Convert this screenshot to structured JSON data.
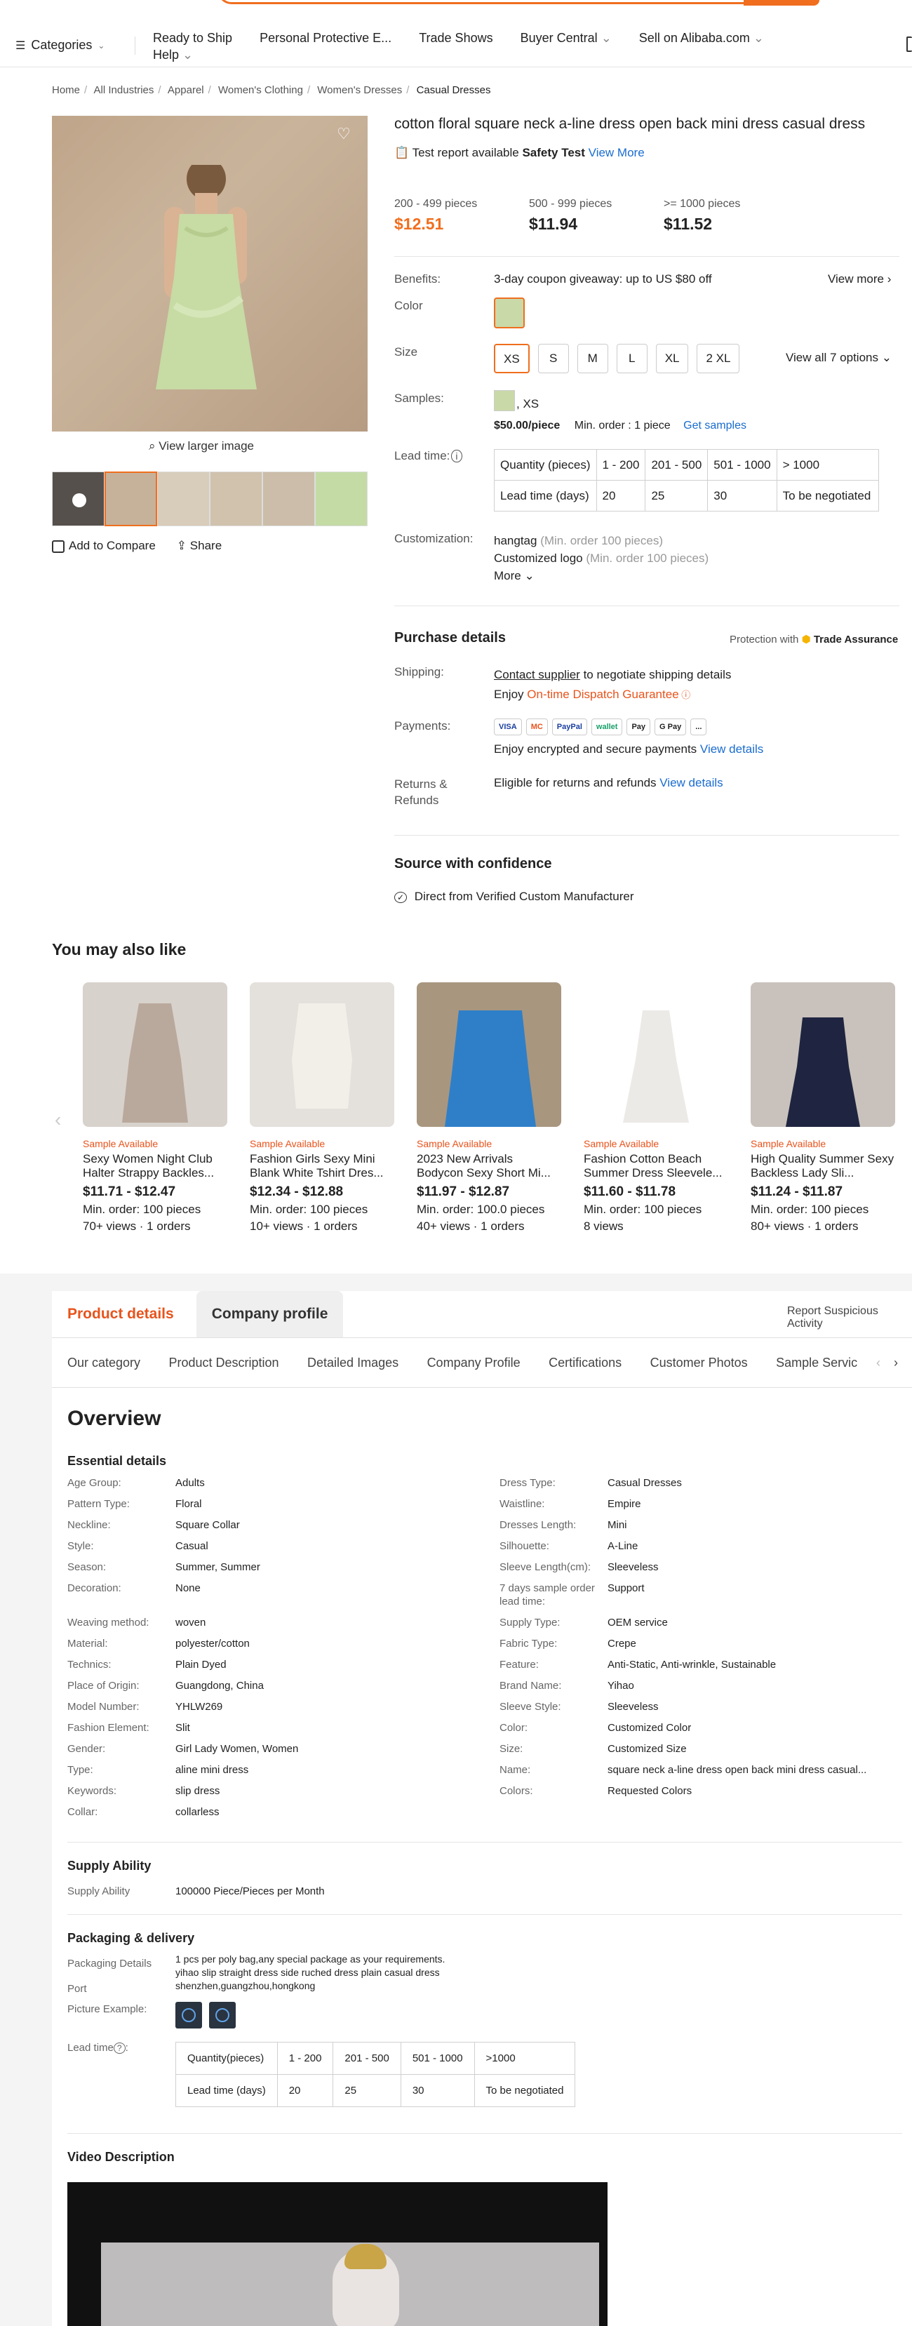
{
  "nav": {
    "categories_label": "Categories",
    "items": [
      "Ready to Ship",
      "Personal Protective E...",
      "Trade Shows",
      "Buyer Central",
      "Sell on Alibaba.com",
      "Help"
    ]
  },
  "breadcrumb": [
    "Home",
    "All Industries",
    "Apparel",
    "Women's Clothing",
    "Women's Dresses",
    "Casual Dresses"
  ],
  "gallery": {
    "view_larger": "View larger image",
    "add_compare": "Add to Compare",
    "share": "Share"
  },
  "product": {
    "title": "cotton floral square neck a-line dress open back mini dress casual dress",
    "report_text": "Test report available",
    "report_bold": "Safety Test",
    "report_link": "View More",
    "tiers": [
      {
        "qty": "200 - 499 pieces",
        "price": "$12.51"
      },
      {
        "qty": "500 - 999 pieces",
        "price": "$11.94"
      },
      {
        "qty": ">= 1000 pieces",
        "price": "$11.52"
      }
    ],
    "benefits_label": "Benefits:",
    "benefits_value": "3-day coupon giveaway: up to US $80 off",
    "view_more": "View more",
    "color_label": "Color",
    "size_label": "Size",
    "sizes": [
      "XS",
      "S",
      "M",
      "L",
      "XL",
      "2 XL"
    ],
    "view_all_options": "View all 7 options",
    "samples_label": "Samples:",
    "sample_size": ", XS",
    "sample_price": "$50.00/piece",
    "sample_min": "Min. order : 1 piece",
    "get_samples": "Get samples",
    "lead_label": "Lead time:",
    "lead_table": {
      "row1": [
        "Quantity (pieces)",
        "1 - 200",
        "201 - 500",
        "501 - 1000",
        "> 1000"
      ],
      "row2": [
        "Lead time (days)",
        "20",
        "25",
        "30",
        "To be negotiated"
      ]
    },
    "custom_label": "Customization:",
    "custom_items": [
      {
        "name": "hangtag",
        "note": "(Min. order 100 pieces)"
      },
      {
        "name": "Customized logo",
        "note": "(Min. order 100 pieces)"
      }
    ],
    "more": "More"
  },
  "purchase": {
    "title": "Purchase details",
    "protection": "Protection with",
    "trade_assurance": "Trade Assurance",
    "shipping_label": "Shipping:",
    "contact_supplier": "Contact supplier",
    "shipping_rest": "to negotiate shipping details",
    "enjoy": "Enjoy",
    "dispatch": "On-time Dispatch Guarantee",
    "payments_label": "Payments:",
    "pay_methods": [
      "VISA",
      "MC",
      "PayPal",
      "wallet",
      "Pay",
      "G Pay",
      "..."
    ],
    "payments_text": "Enjoy encrypted and secure payments",
    "view_details": "View details",
    "returns_label1": "Returns &",
    "returns_label2": "Refunds",
    "returns_text": "Eligible for returns and refunds",
    "returns_link": "View details"
  },
  "source": {
    "title": "Source with confidence",
    "item": "Direct from Verified Custom Manufacturer"
  },
  "also": {
    "title": "You may also like",
    "cards": [
      {
        "avail": "Sample Available",
        "name": "Sexy Women Night Club Halter Strappy Backles...",
        "price": "$11.71 - $12.47",
        "min": "Min. order: 100 pieces",
        "views": "70+ views · 1 orders",
        "bg": "#d8d2cc",
        "dress": "#b9a99c"
      },
      {
        "avail": "Sample Available",
        "name": "Fashion Girls Sexy Mini Blank White Tshirt Dres...",
        "price": "$12.34 - $12.88",
        "min": "Min. order: 100 pieces",
        "views": "10+ views · 1 orders",
        "bg": "#e4e0dc",
        "dress": "#f2efe8"
      },
      {
        "avail": "Sample Available",
        "name": "2023 New Arrivals Bodycon Sexy Short Mi...",
        "price": "$11.97 - $12.87",
        "min": "Min. order: 100.0 pieces",
        "views": "40+ views · 1 orders",
        "bg": "#a9967f",
        "dress": "#2f7fc8"
      },
      {
        "avail": "Sample Available",
        "name": "Fashion Cotton Beach Summer Dress Sleevele...",
        "price": "$11.60 - $11.78",
        "min": "Min. order: 100 pieces",
        "views": "8 views",
        "bg": "#ffffff",
        "dress": "#eceae6"
      },
      {
        "avail": "Sample Available",
        "name": "High Quality Summer Sexy Backless Lady Sli...",
        "price": "$11.24 - $11.87",
        "min": "Min. order: 100 pieces",
        "views": "80+ views · 1 orders",
        "bg": "#c9c2bc",
        "dress": "#1f2540"
      }
    ]
  },
  "details": {
    "tab_product": "Product details",
    "tab_company": "Company profile",
    "report": "Report Suspicious Activity",
    "subtabs": [
      "Our category",
      "Product Description",
      "Detailed Images",
      "Company Profile",
      "Certifications",
      "Customer Photos",
      "Sample Servic"
    ],
    "overview": "Overview",
    "essential": "Essential details",
    "attrs": [
      [
        "Age Group:",
        "Adults",
        "Dress Type:",
        "Casual Dresses"
      ],
      [
        "Pattern Type:",
        "Floral",
        "Waistline:",
        "Empire"
      ],
      [
        "Neckline:",
        "Square Collar",
        "Dresses Length:",
        "Mini"
      ],
      [
        "Style:",
        "Casual",
        "Silhouette:",
        "A-Line"
      ],
      [
        "Season:",
        "Summer, Summer",
        "Sleeve Length(cm):",
        "Sleeveless"
      ],
      [
        "Decoration:",
        "None",
        "7 days sample order lead time:",
        "Support"
      ],
      [
        "Weaving method:",
        "woven",
        "Supply Type:",
        "OEM service"
      ],
      [
        "Material:",
        "polyester/cotton",
        "Fabric Type:",
        "Crepe"
      ],
      [
        "Technics:",
        "Plain Dyed",
        "Feature:",
        "Anti-Static, Anti-wrinkle, Sustainable"
      ],
      [
        "Place of Origin:",
        "Guangdong, China",
        "Brand Name:",
        "Yihao"
      ],
      [
        "Model Number:",
        "YHLW269",
        "Sleeve Style:",
        "Sleeveless"
      ],
      [
        "Fashion Element:",
        "Slit",
        "Color:",
        "Customized Color"
      ],
      [
        "Gender:",
        "Girl Lady Women, Women",
        "Size:",
        "Customized Size"
      ],
      [
        "Type:",
        "aline mini dress",
        "Name:",
        "square neck a-line dress open back mini dress casual..."
      ],
      [
        "Keywords:",
        "slip dress",
        "Colors:",
        "Requested Colors"
      ],
      [
        "Collar:",
        "collarless",
        "",
        ""
      ]
    ],
    "supply_title": "Supply Ability",
    "supply_label": "Supply Ability",
    "supply_value": "100000 Piece/Pieces per Month",
    "pack_title": "Packaging & delivery",
    "pack_label": "Packaging Details",
    "pack_value1": "1 pcs per poly bag,any special package as your requirements.",
    "pack_value2": "yihao slip straight dress side ruched dress plain casual dress",
    "port_label": "Port",
    "port_value": "shenzhen,guangzhou,hongkong",
    "picture_label": "Picture Example:",
    "lead_label": "Lead time",
    "lead_table": {
      "row1": [
        "Quantity(pieces)",
        "1 - 200",
        "201 - 500",
        "501 - 1000",
        ">1000"
      ],
      "row2": [
        "Lead time (days)",
        "20",
        "25",
        "30",
        "To be negotiated"
      ]
    },
    "video_title": "Video Description"
  },
  "colors": {
    "accent": "#f06e1e",
    "link": "#1a6cd0",
    "sample": "#e8531c"
  }
}
